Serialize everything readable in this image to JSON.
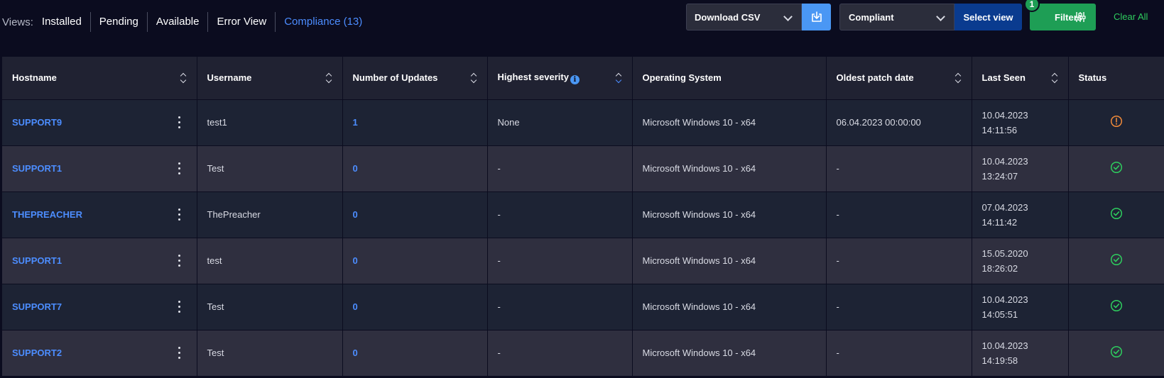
{
  "views": {
    "label": "Views:",
    "items": [
      {
        "label": "Installed",
        "active": false
      },
      {
        "label": "Pending",
        "active": false
      },
      {
        "label": "Available",
        "active": false
      },
      {
        "label": "Error View",
        "active": false
      },
      {
        "label": "Compliance (13)",
        "active": true
      }
    ]
  },
  "toolbar": {
    "download_select": "Download CSV",
    "view_select": "Compliant",
    "select_view_label": "Select view",
    "filters_label": "Filters",
    "filters_badge": "1",
    "clear_all_label": "Clear All"
  },
  "colors": {
    "accent": "#4c8dff",
    "success": "#2ecc5e",
    "warning": "#f08a3a",
    "filters": "#1e9e55"
  },
  "table": {
    "columns": [
      "Hostname",
      "Username",
      "Number of Updates",
      "Highest severity",
      "Operating System",
      "Oldest patch date",
      "Last Seen",
      "Status"
    ],
    "rows": [
      {
        "hostname": "SUPPORT9",
        "username": "test1",
        "updates": "1",
        "severity": "None",
        "os": "Microsoft Windows 10 - x64",
        "oldest": "06.04.2023  00:00:00",
        "seen_date": "10.04.2023",
        "seen_time": "14:11:56",
        "status": "warning-icon"
      },
      {
        "hostname": "SUPPORT1",
        "username": "Test",
        "updates": "0",
        "severity": "-",
        "os": "Microsoft Windows 10 - x64",
        "oldest": "-",
        "seen_date": "10.04.2023",
        "seen_time": "13:24:07",
        "status": "check-circle-icon"
      },
      {
        "hostname": "THEPREACHER",
        "username": "ThePreacher",
        "updates": "0",
        "severity": "-",
        "os": "Microsoft Windows 10 - x64",
        "oldest": "-",
        "seen_date": "07.04.2023",
        "seen_time": "14:11:42",
        "status": "check-circle-icon"
      },
      {
        "hostname": "SUPPORT1",
        "username": "test",
        "updates": "0",
        "severity": "-",
        "os": "Microsoft Windows 10 - x64",
        "oldest": "-",
        "seen_date": "15.05.2020",
        "seen_time": "18:26:02",
        "status": "check-circle-icon"
      },
      {
        "hostname": "SUPPORT7",
        "username": "Test",
        "updates": "0",
        "severity": "-",
        "os": "Microsoft Windows 10 - x64",
        "oldest": "-",
        "seen_date": "10.04.2023",
        "seen_time": "14:05:51",
        "status": "check-circle-icon"
      },
      {
        "hostname": "SUPPORT2",
        "username": "Test",
        "updates": "0",
        "severity": "-",
        "os": "Microsoft Windows 10 - x64",
        "oldest": "-",
        "seen_date": "10.04.2023",
        "seen_time": "14:19:58",
        "status": "check-circle-icon"
      }
    ]
  }
}
